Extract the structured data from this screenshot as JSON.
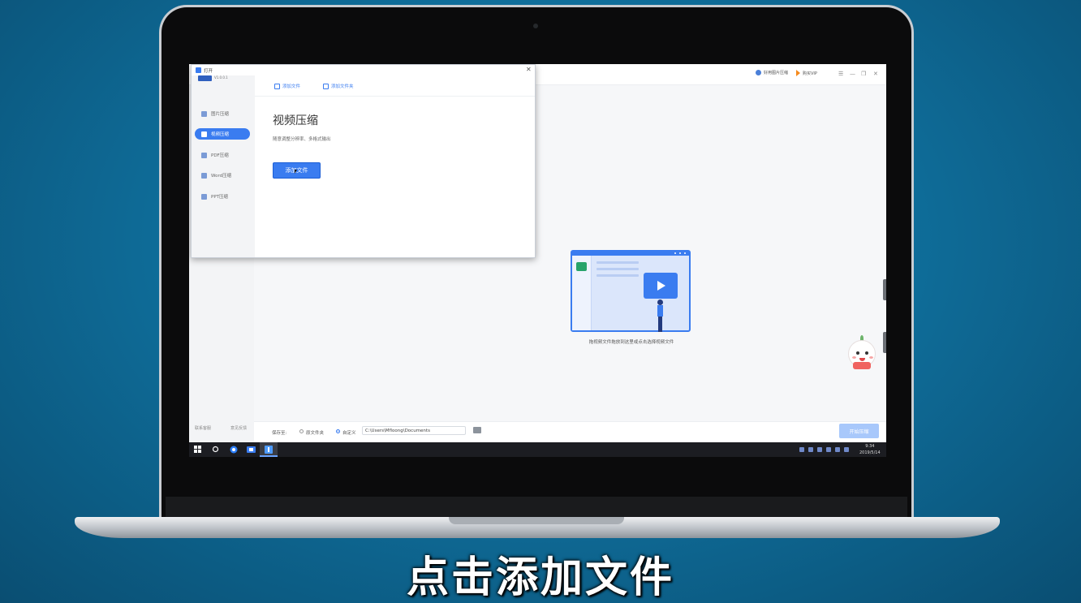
{
  "main_window": {
    "user_label": "好用图片压缩",
    "vip_label": "购买VIP",
    "controls": [
      "☰",
      "—",
      "❐",
      "✕"
    ],
    "sidebar_footer": [
      "联系客服",
      "意见反馈"
    ],
    "drop_hint": "拖视频文件拖放到这里或点击选择视频文件",
    "save_to_label": "保存至:",
    "radio_original": "原文件夹",
    "radio_custom": "自定义",
    "save_path": "C:\\Users\\Mfloong\\Documents",
    "start_button": "开始压缩"
  },
  "dialog": {
    "title": "打开",
    "version": "V1.0.0.1",
    "close_icon": "✕",
    "nav_items": [
      {
        "label": "图片压缩",
        "icon": "image-icon"
      },
      {
        "label": "视频压缩",
        "icon": "video-icon"
      },
      {
        "label": "PDF压缩",
        "icon": "pdf-icon"
      },
      {
        "label": "Word压缩",
        "icon": "word-icon"
      },
      {
        "label": "PPT压缩",
        "icon": "ppt-icon"
      }
    ],
    "active_nav": "视频压缩",
    "toolbar": {
      "add_file": "添加文件",
      "add_folder": "添加文件夹"
    },
    "heading": "视频压缩",
    "subtitle": "随意调整分辨率、多格式输出",
    "add_button": "添加文件"
  },
  "taskbar": {
    "time": "9:34",
    "date": "2019/5/14"
  },
  "caption": "点击添加文件",
  "colors": {
    "accent": "#3a7cf0",
    "background": "#0f6f9c"
  }
}
